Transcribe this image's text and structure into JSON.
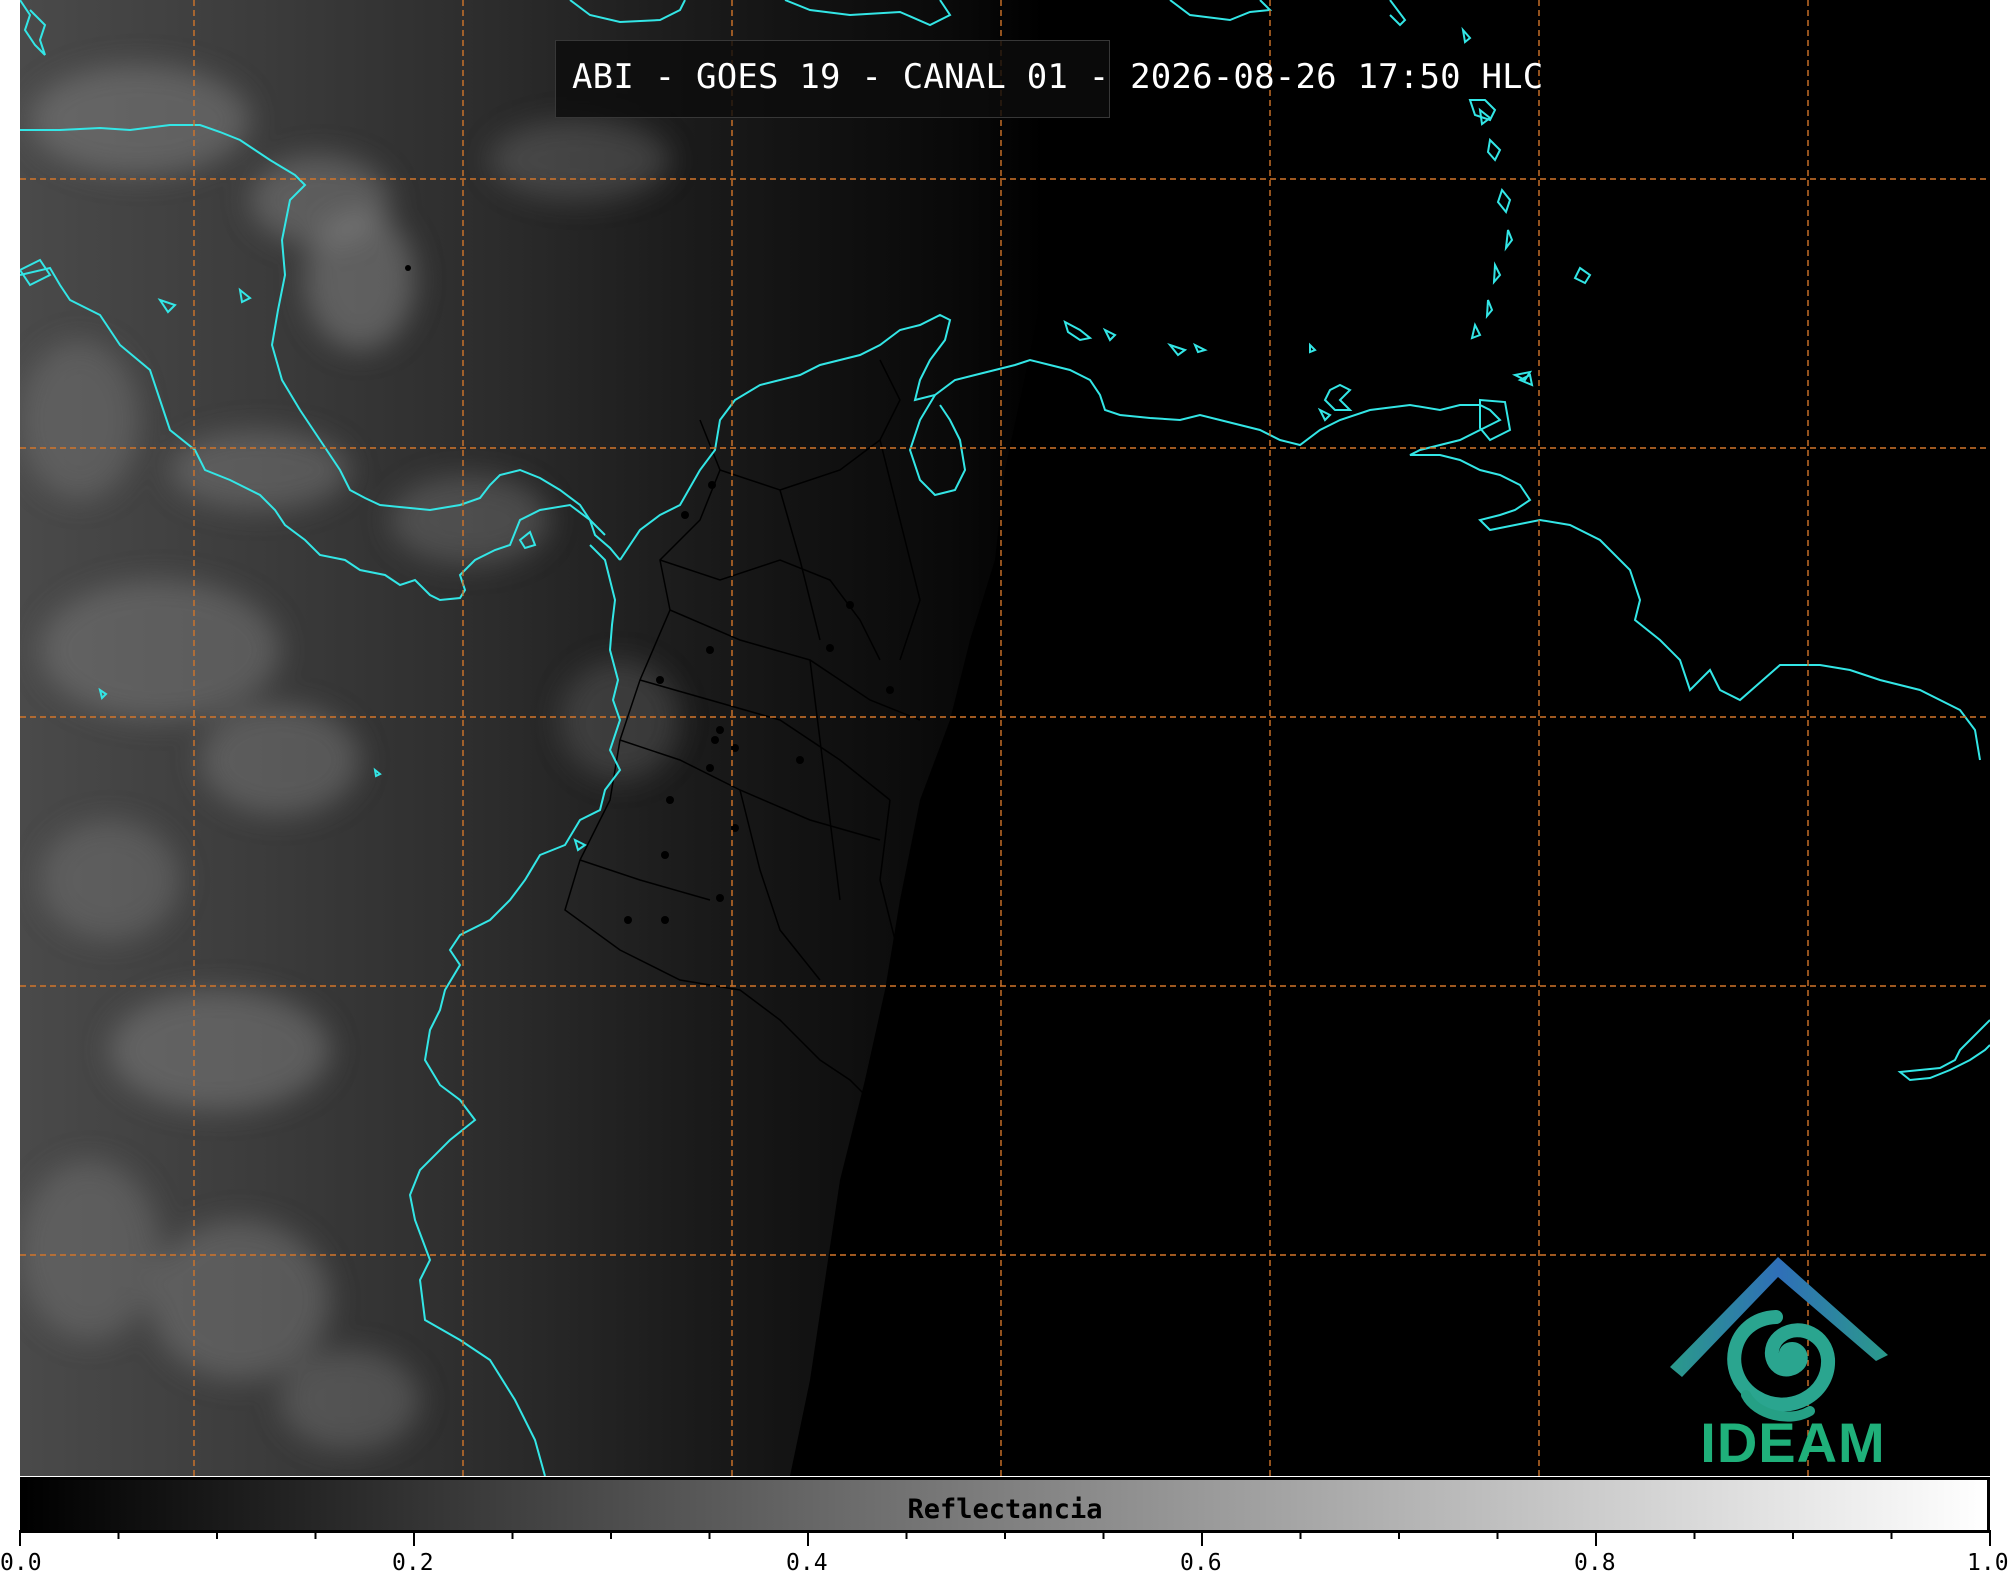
{
  "title": "ABI - GOES 19 - CANAL 01 - 2026-08-26 17:50 HLC",
  "colorbar": {
    "label": "Reflectancia",
    "min": 0.0,
    "max": 1.0,
    "major_ticks": [
      "0.0",
      "0.2",
      "0.4",
      "0.6",
      "0.8",
      "1.0"
    ],
    "minor_step": 0.05,
    "gradient": [
      "#000000",
      "#ffffff"
    ]
  },
  "logo": {
    "text": "IDEAM",
    "text_color": "#1fb07a",
    "roof_color": "#2f86c0",
    "spiral_color": "#2aa58f"
  },
  "colors": {
    "coastline": "#33e6e6",
    "gridline": "#d2752a",
    "borders": "#000000",
    "night": "#000000"
  },
  "icons": [
    "ideam-logo-icon",
    "city-marker-icon"
  ]
}
